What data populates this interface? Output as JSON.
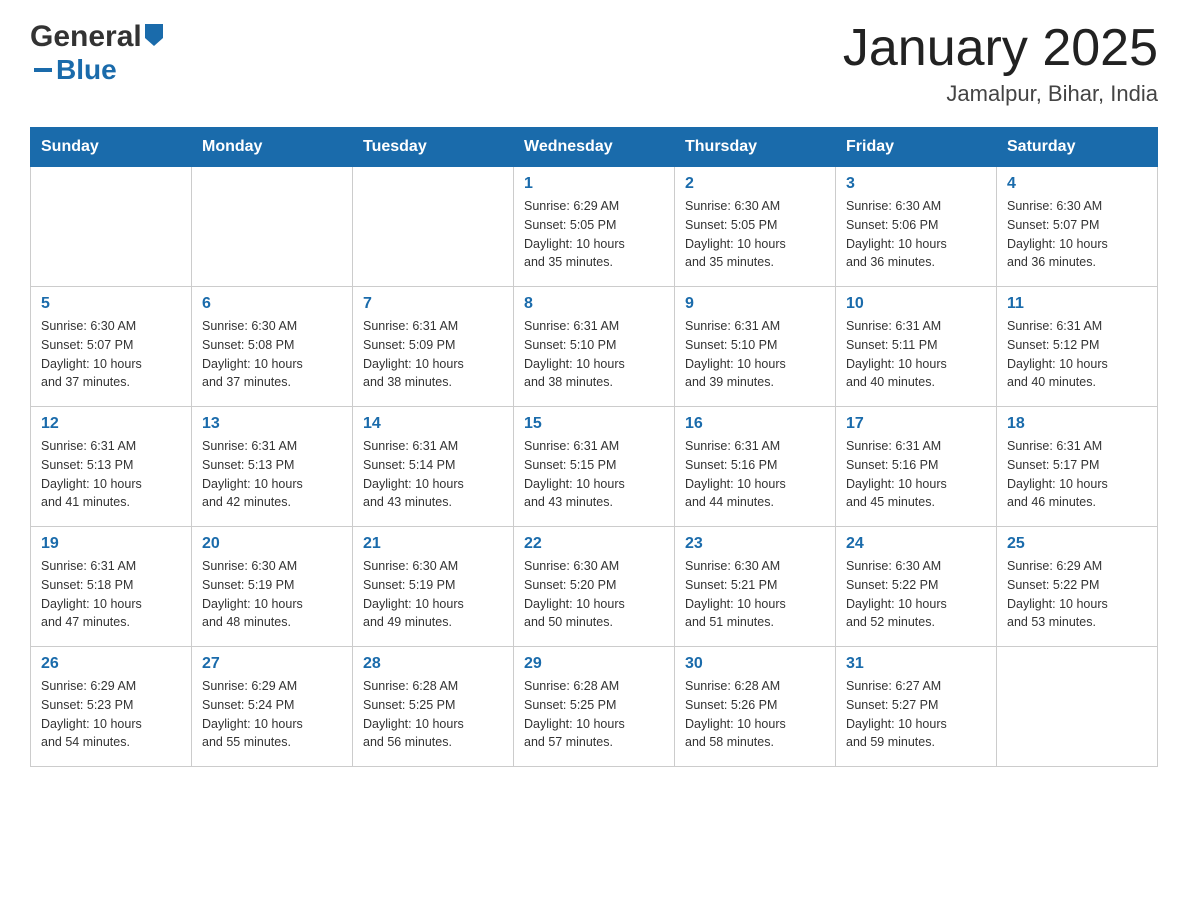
{
  "header": {
    "logo": {
      "general": "General",
      "blue": "Blue",
      "arrow": "▶"
    },
    "month_title": "January 2025",
    "location": "Jamalpur, Bihar, India"
  },
  "calendar": {
    "days_of_week": [
      "Sunday",
      "Monday",
      "Tuesday",
      "Wednesday",
      "Thursday",
      "Friday",
      "Saturday"
    ],
    "weeks": [
      [
        {
          "day": "",
          "info": ""
        },
        {
          "day": "",
          "info": ""
        },
        {
          "day": "",
          "info": ""
        },
        {
          "day": "1",
          "info": "Sunrise: 6:29 AM\nSunset: 5:05 PM\nDaylight: 10 hours\nand 35 minutes."
        },
        {
          "day": "2",
          "info": "Sunrise: 6:30 AM\nSunset: 5:05 PM\nDaylight: 10 hours\nand 35 minutes."
        },
        {
          "day": "3",
          "info": "Sunrise: 6:30 AM\nSunset: 5:06 PM\nDaylight: 10 hours\nand 36 minutes."
        },
        {
          "day": "4",
          "info": "Sunrise: 6:30 AM\nSunset: 5:07 PM\nDaylight: 10 hours\nand 36 minutes."
        }
      ],
      [
        {
          "day": "5",
          "info": "Sunrise: 6:30 AM\nSunset: 5:07 PM\nDaylight: 10 hours\nand 37 minutes."
        },
        {
          "day": "6",
          "info": "Sunrise: 6:30 AM\nSunset: 5:08 PM\nDaylight: 10 hours\nand 37 minutes."
        },
        {
          "day": "7",
          "info": "Sunrise: 6:31 AM\nSunset: 5:09 PM\nDaylight: 10 hours\nand 38 minutes."
        },
        {
          "day": "8",
          "info": "Sunrise: 6:31 AM\nSunset: 5:10 PM\nDaylight: 10 hours\nand 38 minutes."
        },
        {
          "day": "9",
          "info": "Sunrise: 6:31 AM\nSunset: 5:10 PM\nDaylight: 10 hours\nand 39 minutes."
        },
        {
          "day": "10",
          "info": "Sunrise: 6:31 AM\nSunset: 5:11 PM\nDaylight: 10 hours\nand 40 minutes."
        },
        {
          "day": "11",
          "info": "Sunrise: 6:31 AM\nSunset: 5:12 PM\nDaylight: 10 hours\nand 40 minutes."
        }
      ],
      [
        {
          "day": "12",
          "info": "Sunrise: 6:31 AM\nSunset: 5:13 PM\nDaylight: 10 hours\nand 41 minutes."
        },
        {
          "day": "13",
          "info": "Sunrise: 6:31 AM\nSunset: 5:13 PM\nDaylight: 10 hours\nand 42 minutes."
        },
        {
          "day": "14",
          "info": "Sunrise: 6:31 AM\nSunset: 5:14 PM\nDaylight: 10 hours\nand 43 minutes."
        },
        {
          "day": "15",
          "info": "Sunrise: 6:31 AM\nSunset: 5:15 PM\nDaylight: 10 hours\nand 43 minutes."
        },
        {
          "day": "16",
          "info": "Sunrise: 6:31 AM\nSunset: 5:16 PM\nDaylight: 10 hours\nand 44 minutes."
        },
        {
          "day": "17",
          "info": "Sunrise: 6:31 AM\nSunset: 5:16 PM\nDaylight: 10 hours\nand 45 minutes."
        },
        {
          "day": "18",
          "info": "Sunrise: 6:31 AM\nSunset: 5:17 PM\nDaylight: 10 hours\nand 46 minutes."
        }
      ],
      [
        {
          "day": "19",
          "info": "Sunrise: 6:31 AM\nSunset: 5:18 PM\nDaylight: 10 hours\nand 47 minutes."
        },
        {
          "day": "20",
          "info": "Sunrise: 6:30 AM\nSunset: 5:19 PM\nDaylight: 10 hours\nand 48 minutes."
        },
        {
          "day": "21",
          "info": "Sunrise: 6:30 AM\nSunset: 5:19 PM\nDaylight: 10 hours\nand 49 minutes."
        },
        {
          "day": "22",
          "info": "Sunrise: 6:30 AM\nSunset: 5:20 PM\nDaylight: 10 hours\nand 50 minutes."
        },
        {
          "day": "23",
          "info": "Sunrise: 6:30 AM\nSunset: 5:21 PM\nDaylight: 10 hours\nand 51 minutes."
        },
        {
          "day": "24",
          "info": "Sunrise: 6:30 AM\nSunset: 5:22 PM\nDaylight: 10 hours\nand 52 minutes."
        },
        {
          "day": "25",
          "info": "Sunrise: 6:29 AM\nSunset: 5:22 PM\nDaylight: 10 hours\nand 53 minutes."
        }
      ],
      [
        {
          "day": "26",
          "info": "Sunrise: 6:29 AM\nSunset: 5:23 PM\nDaylight: 10 hours\nand 54 minutes."
        },
        {
          "day": "27",
          "info": "Sunrise: 6:29 AM\nSunset: 5:24 PM\nDaylight: 10 hours\nand 55 minutes."
        },
        {
          "day": "28",
          "info": "Sunrise: 6:28 AM\nSunset: 5:25 PM\nDaylight: 10 hours\nand 56 minutes."
        },
        {
          "day": "29",
          "info": "Sunrise: 6:28 AM\nSunset: 5:25 PM\nDaylight: 10 hours\nand 57 minutes."
        },
        {
          "day": "30",
          "info": "Sunrise: 6:28 AM\nSunset: 5:26 PM\nDaylight: 10 hours\nand 58 minutes."
        },
        {
          "day": "31",
          "info": "Sunrise: 6:27 AM\nSunset: 5:27 PM\nDaylight: 10 hours\nand 59 minutes."
        },
        {
          "day": "",
          "info": ""
        }
      ]
    ]
  }
}
